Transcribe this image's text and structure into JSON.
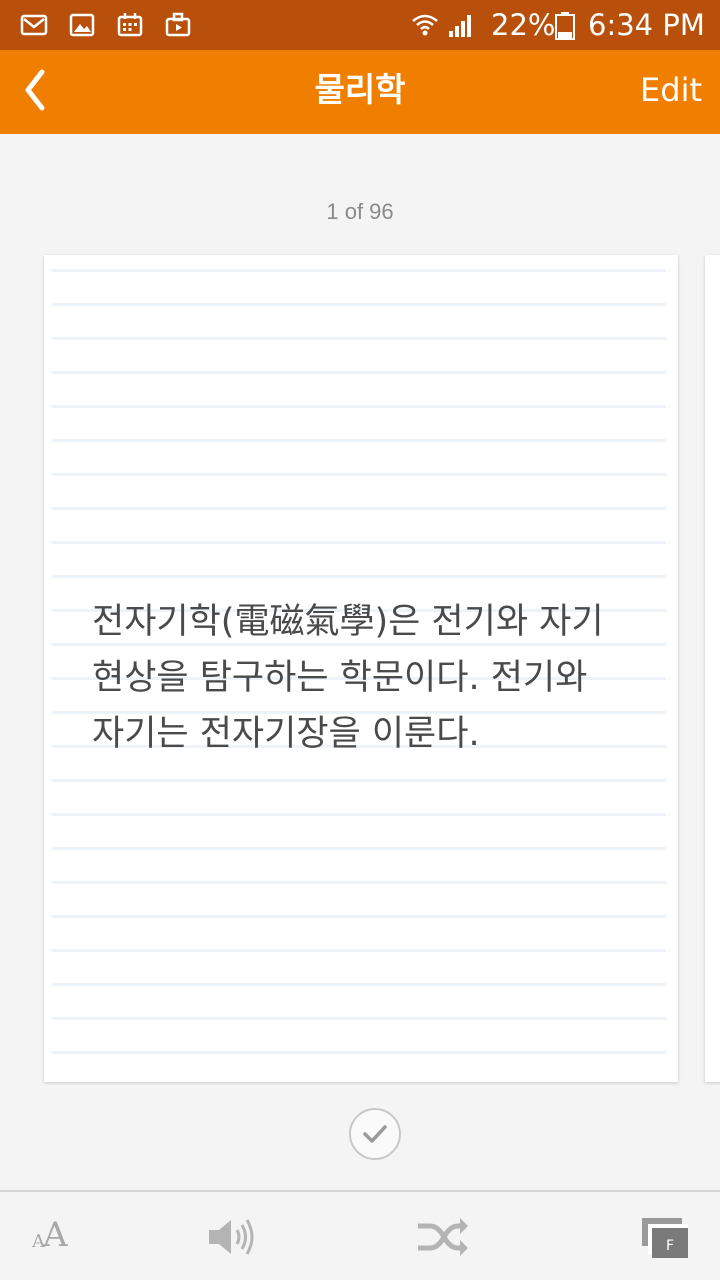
{
  "status_bar": {
    "icons": [
      "gmail-icon",
      "gallery-icon",
      "calendar-icon",
      "briefcase-icon"
    ],
    "signal_icons": [
      "wifi-icon",
      "cell-signal-icon",
      "battery-icon"
    ],
    "battery": "22%",
    "time": "6:34 PM"
  },
  "app_bar": {
    "title": "물리학",
    "edit_label": "Edit",
    "back_icon": "chevron-left-icon"
  },
  "counter": "1 of 96",
  "card": {
    "text": "전자기학(電磁氣學)은 전기와 자기 현상을 탐구하는 학문이다. 전기와 자기는 전자기장을 이룬다."
  },
  "check_icon": "check-icon",
  "toolbar": {
    "font_small": "A",
    "font_big": "A",
    "items": [
      "font-size-icon",
      "speaker-icon",
      "shuffle-icon",
      "flashcard-mode-icon"
    ],
    "mode_badge": "F"
  },
  "colors": {
    "status_bar": "#b8500b",
    "app_bar": "#f07f00",
    "background": "#f4f4f4",
    "card_text": "#4a4a4a",
    "toolbar_icon": "#a8a8a8"
  }
}
